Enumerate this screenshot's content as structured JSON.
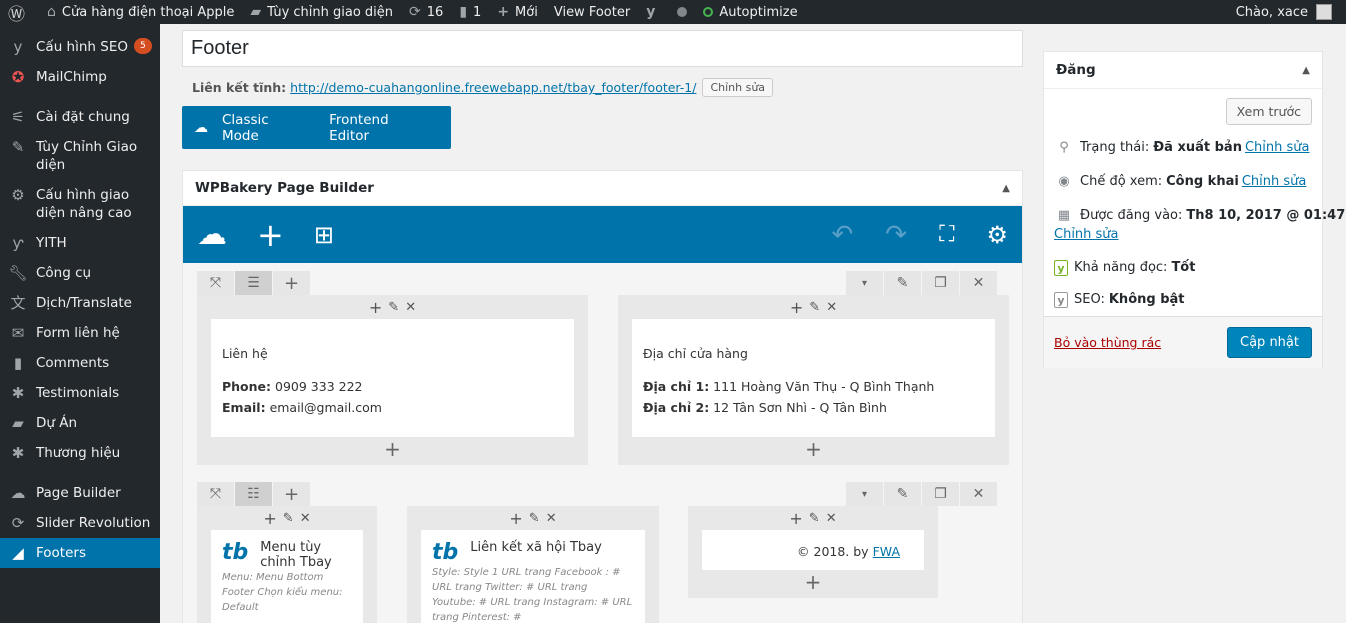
{
  "adminbar": {
    "site_name": "Cửa hàng điện thoại Apple",
    "customize": "Tùy chỉnh giao diện",
    "updates": "16",
    "comments": "1",
    "new": "Mới",
    "view": "View Footer",
    "autoptimize": "Autoptimize",
    "greeting": "Chào, xace"
  },
  "sidebar": {
    "items": [
      {
        "label": "Cấu hình SEO",
        "icon": "yoast-icon",
        "badge": "5"
      },
      {
        "label": "MailChimp",
        "icon": "mailchimp-icon"
      },
      {
        "label": "Cài đặt chung",
        "icon": "settings-sliders-icon"
      },
      {
        "label": "Tùy Chỉnh Giao diện",
        "icon": "brush-icon"
      },
      {
        "label": "Cấu hình giao diện nâng cao",
        "icon": "gear-icon"
      },
      {
        "label": "YITH",
        "icon": "yith-icon"
      },
      {
        "label": "Công cụ",
        "icon": "wrench-icon"
      },
      {
        "label": "Dịch/Translate",
        "icon": "translate-icon"
      },
      {
        "label": "Form liên hệ",
        "icon": "mail-icon"
      },
      {
        "label": "Comments",
        "icon": "comment-icon"
      },
      {
        "label": "Testimonials",
        "icon": "pin-icon"
      },
      {
        "label": "Dự Án",
        "icon": "folder-icon"
      },
      {
        "label": "Thương hiệu",
        "icon": "pin-icon"
      },
      {
        "label": "Page Builder",
        "icon": "cloud-icon"
      },
      {
        "label": "Slider Revolution",
        "icon": "refresh-icon"
      },
      {
        "label": "Footers",
        "icon": "footer-icon"
      }
    ]
  },
  "post": {
    "title": "Footer",
    "permalink_label": "Liên kết tĩnh:",
    "permalink_url": "http://demo-cuahangonline.freewebapp.net/tbay_footer/footer-1/",
    "edit_label": "Chỉnh sửa"
  },
  "modes": {
    "classic": "Classic Mode",
    "frontend": "Frontend Editor"
  },
  "wpb": {
    "title": "WPBakery Page Builder",
    "col1": {
      "heading": "Liên hệ",
      "phone_label": "Phone:",
      "phone": "0909 333 222",
      "email_label": "Email:",
      "email": "email@gmail.com"
    },
    "col2": {
      "heading": "Địa chỉ cửa hàng",
      "addr1_label": "Địa chỉ 1:",
      "addr1": "111 Hoàng Văn Thụ - Q Bình Thạnh",
      "addr2_label": "Địa chỉ 2:",
      "addr2": "12 Tân Sơn Nhì - Q Tân Bình"
    },
    "w1": {
      "logo": "tb",
      "title": "Menu tùy chỉnh Tbay",
      "meta": "Menu: Menu Bottom Footer Chọn kiểu menu: Default"
    },
    "w2": {
      "logo": "tb",
      "title": "Liên kết xã hội Tbay",
      "meta": "Style: Style 1 URL trang Facebook : # URL trang Twitter: # URL trang Youtube: # URL trang Instagram: # URL trang Pinterest: #"
    },
    "w3": {
      "text": "© 2018. by",
      "link": "FWA"
    }
  },
  "publish": {
    "title": "Đăng",
    "preview": "Xem trước",
    "status_label": "Trạng thái:",
    "status": "Đã xuất bản",
    "visibility_label": "Chế độ xem:",
    "visibility": "Công khai",
    "date_label": "Được đăng vào:",
    "date": "Th8 10, 2017 @ 01:47",
    "readability_label": "Khả năng đọc:",
    "readability": "Tốt",
    "seo_label": "SEO:",
    "seo": "Không bật",
    "edit": "Chỉnh sửa",
    "trash": "Bỏ vào thùng rác",
    "update": "Cập nhật"
  }
}
